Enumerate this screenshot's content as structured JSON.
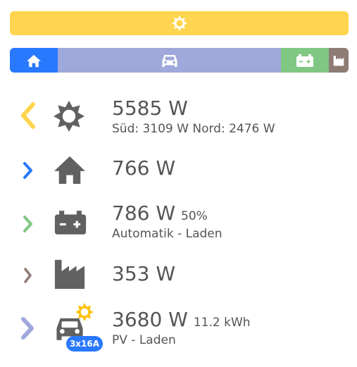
{
  "colors": {
    "solar": "#FFD54F",
    "house": "#2979FF",
    "car": "#9FA8DA",
    "battery": "#81C784",
    "grid": "#8D7B74",
    "icon": "#616161",
    "text": "#555555"
  },
  "topbar": {
    "icon": "sun-icon"
  },
  "flowbar": {
    "segments": [
      {
        "name": "house",
        "icon": "home-icon",
        "share": 0.14
      },
      {
        "name": "car",
        "icon": "car-icon",
        "share": 0.66
      },
      {
        "name": "battery",
        "icon": "battery-icon",
        "share": 0.14
      },
      {
        "name": "grid",
        "icon": "factory-icon",
        "share": 0.06
      }
    ]
  },
  "rows": {
    "pv": {
      "icon": "sun-icon",
      "value": "5585 W",
      "detail": "Süd: 3109 W Nord: 2476 W"
    },
    "house": {
      "icon": "home-icon",
      "value": "766 W"
    },
    "battery": {
      "icon": "battery-icon",
      "value": "786 W",
      "soc": "50%",
      "mode": "Automatik - Laden"
    },
    "grid": {
      "icon": "factory-icon",
      "value": "353 W"
    },
    "car": {
      "icon": "car-solar-icon",
      "value": "3680 W",
      "energy": "11.2 kWh",
      "mode": "PV - Laden",
      "badge": "3x16A"
    }
  }
}
